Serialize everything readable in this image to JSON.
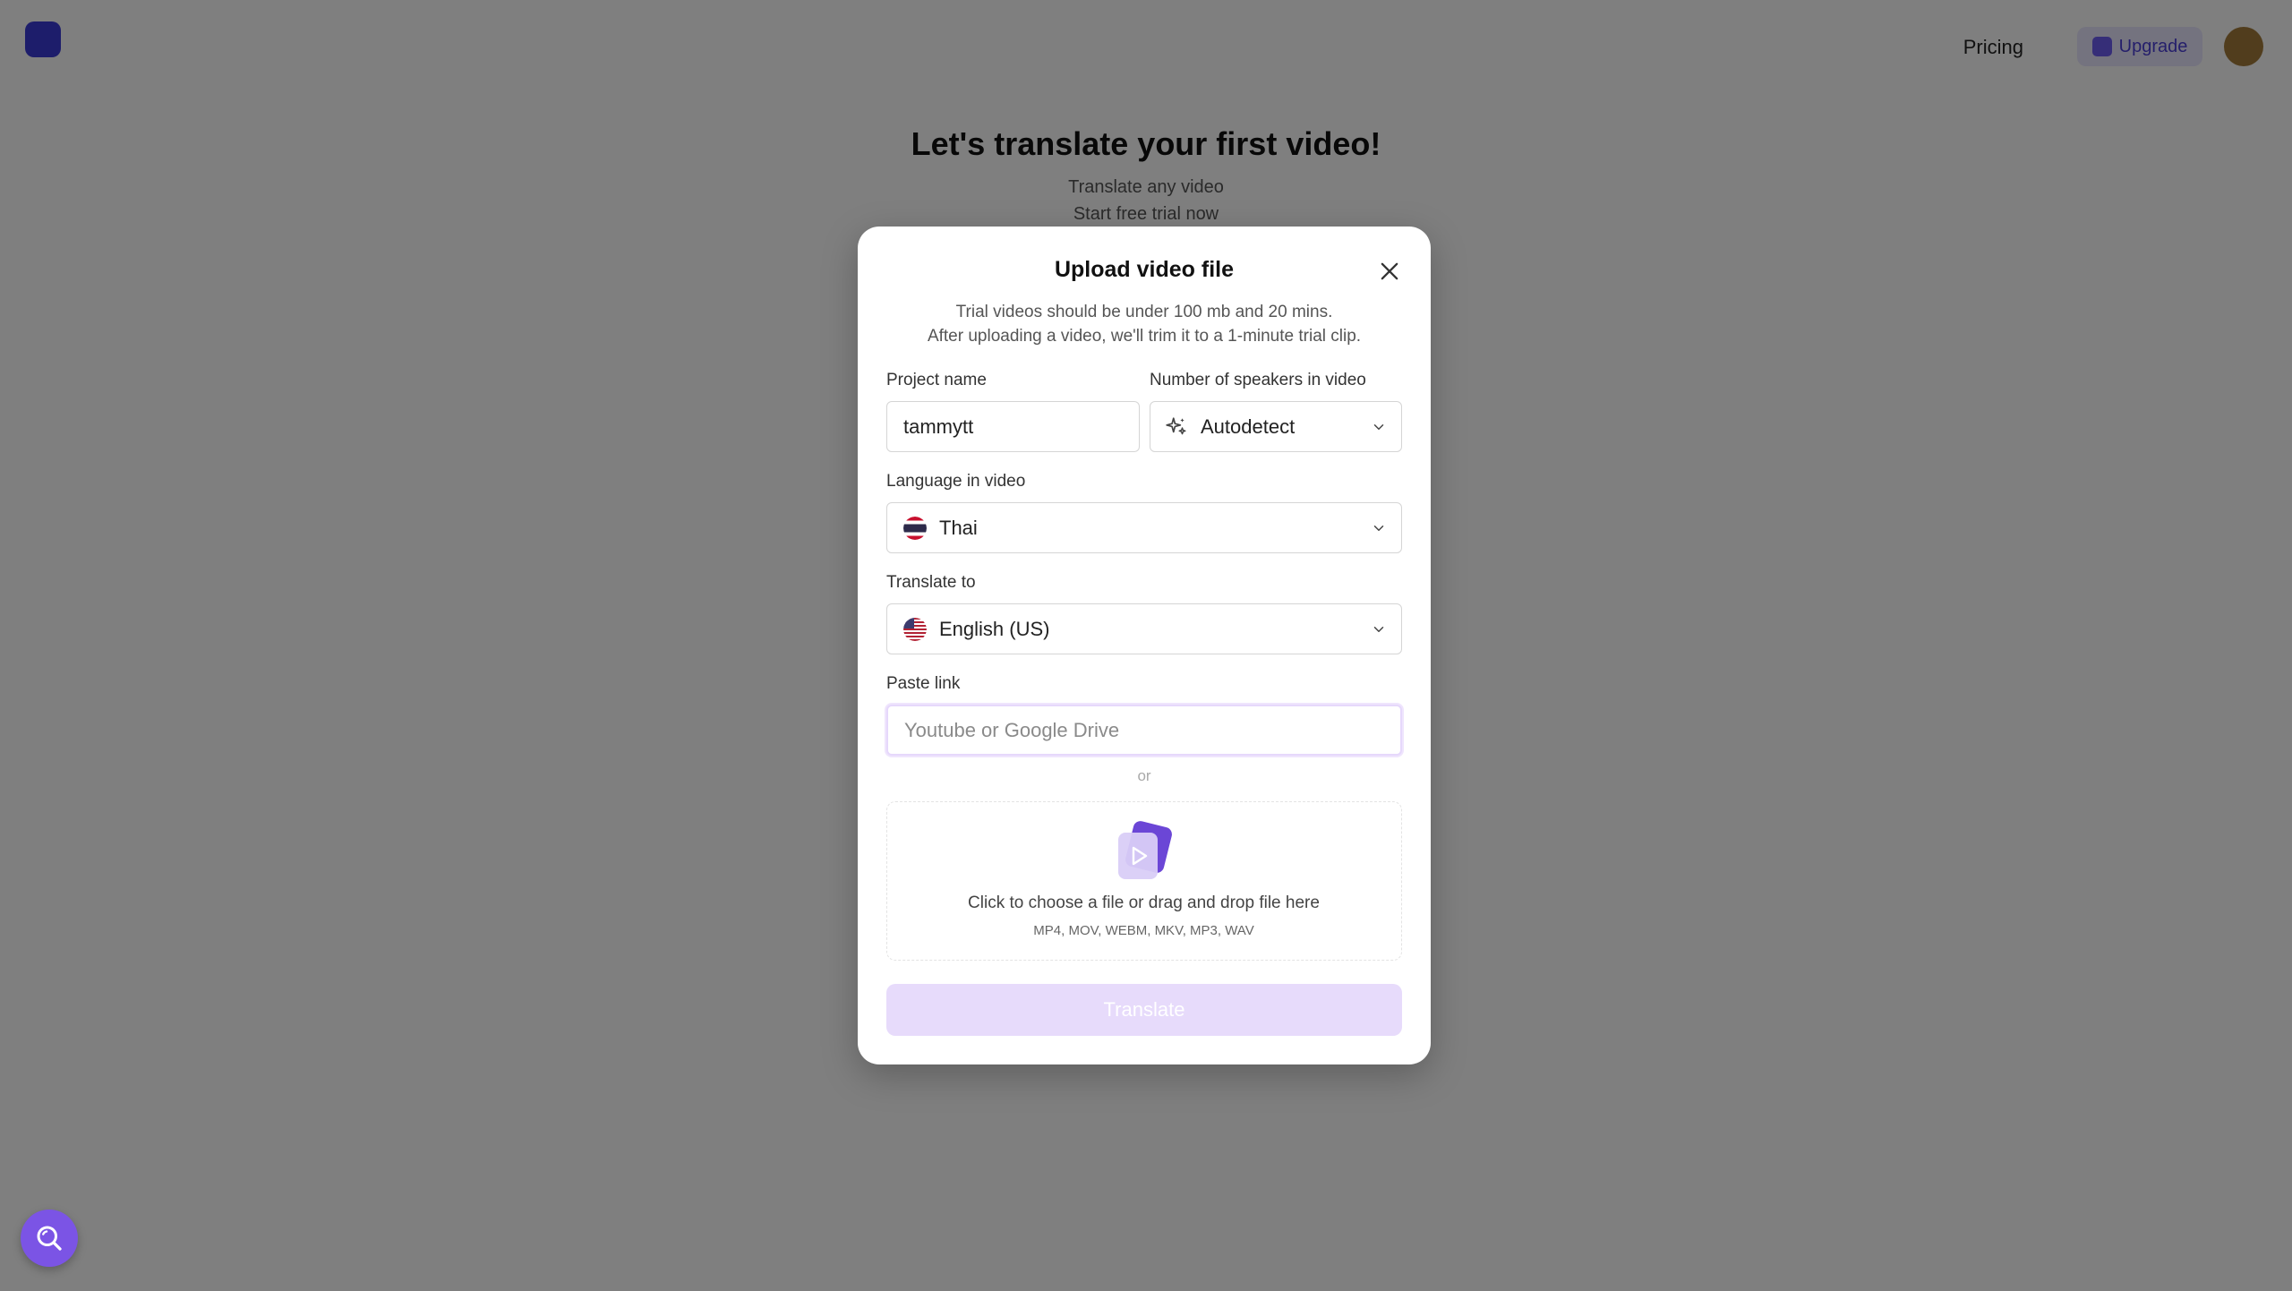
{
  "background": {
    "pricing_label": "Pricing",
    "upgrade_label": "Upgrade",
    "hero_title": "Let's translate your first video!",
    "hero_subtitle_1": "Translate any video",
    "hero_subtitle_2": "Start free trial now"
  },
  "modal": {
    "title": "Upload video file",
    "desc_line1": "Trial videos should be under 100 mb and 20 mins.",
    "desc_line2": "After uploading a video, we'll trim it to a 1-minute trial clip.",
    "project_name": {
      "label": "Project name",
      "value": "tammytt"
    },
    "speakers": {
      "label": "Number of speakers in video",
      "value": "Autodetect"
    },
    "language": {
      "label": "Language in video",
      "value": "Thai"
    },
    "translate_to": {
      "label": "Translate to",
      "value": "English (US)"
    },
    "paste_link": {
      "label": "Paste link",
      "placeholder": "Youtube or Google Drive",
      "value": ""
    },
    "or_label": "or",
    "dropzone": {
      "main_text": "Click to choose a file or drag and drop file here",
      "formats": "MP4, MOV, WEBM, MKV, MP3, WAV"
    },
    "translate_button": "Translate"
  },
  "colors": {
    "accent": "#7b54e5",
    "button_disabled": "#e7dbfb",
    "overlay": "rgba(0,0,0,0.5)"
  },
  "icons": {
    "close": "close-icon",
    "sparkle": "sparkle-icon",
    "chevron": "chevron-down-icon",
    "flag_thai": "thailand-flag-icon",
    "flag_us": "us-flag-icon",
    "upload": "video-file-icon",
    "search": "search-icon"
  }
}
